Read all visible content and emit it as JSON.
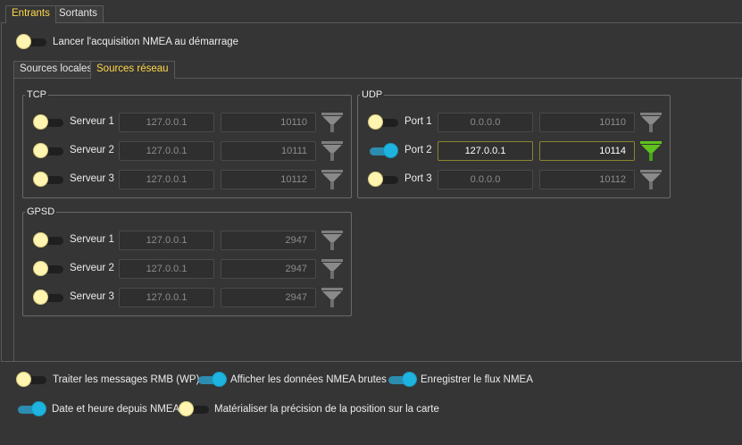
{
  "tabs": {
    "entrants": "Entrants",
    "sortants": "Sortants"
  },
  "startup": {
    "label": "Lancer l'acquisition NMEA au démarrage",
    "on": false
  },
  "subtabs": {
    "locales": "Sources locales",
    "reseau": "Sources réseau"
  },
  "tcp": {
    "title": "TCP",
    "rows": [
      {
        "label": "Serveur 1",
        "ip": "127.0.0.1",
        "port": "10110",
        "on": false
      },
      {
        "label": "Serveur 2",
        "ip": "127.0.0.1",
        "port": "10111",
        "on": false
      },
      {
        "label": "Serveur 3",
        "ip": "127.0.0.1",
        "port": "10112",
        "on": false
      }
    ]
  },
  "udp": {
    "title": "UDP",
    "rows": [
      {
        "label": "Port 1",
        "ip": "0.0.0.0",
        "port": "10110",
        "on": false
      },
      {
        "label": "Port 2",
        "ip": "127.0.0.1",
        "port": "10114",
        "on": true
      },
      {
        "label": "Port 3",
        "ip": "0.0.0.0",
        "port": "10112",
        "on": false
      }
    ]
  },
  "gpsd": {
    "title": "GPSD",
    "rows": [
      {
        "label": "Serveur 1",
        "ip": "127.0.0.1",
        "port": "2947",
        "on": false
      },
      {
        "label": "Serveur 2",
        "ip": "127.0.0.1",
        "port": "2947",
        "on": false
      },
      {
        "label": "Serveur 3",
        "ip": "127.0.0.1",
        "port": "2947",
        "on": false
      }
    ]
  },
  "options": {
    "rmb": {
      "label": "Traiter les messages RMB (WP)",
      "on": false
    },
    "raw": {
      "label": "Afficher les données NMEA brutes",
      "on": true
    },
    "record": {
      "label": "Enregistrer le flux NMEA",
      "on": true
    },
    "datetime": {
      "label": "Date et heure depuis NMEA",
      "on": true
    },
    "precision": {
      "label": "Matérialiser la précision de la position sur la carte",
      "on": false
    }
  },
  "colors": {
    "accent_tab": "#ffd84a",
    "toggle_on": "#1fb4df",
    "toggle_off": "#fff4b0",
    "filter_active": "#5fc21d",
    "filter_inactive": "#8a8a8a"
  }
}
